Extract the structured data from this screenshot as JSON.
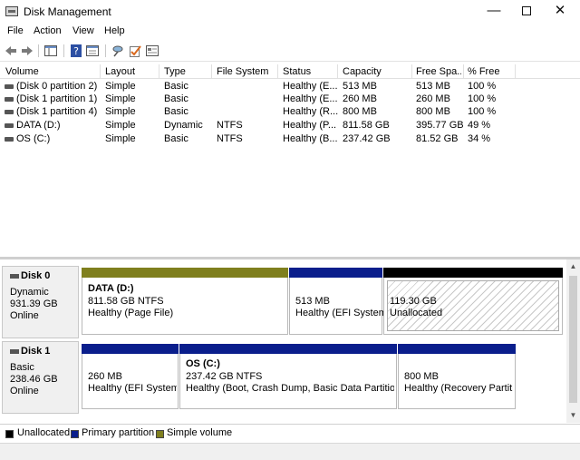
{
  "window": {
    "title": "Disk Management",
    "min": "—",
    "close": "✕"
  },
  "menu": [
    "File",
    "Action",
    "View",
    "Help"
  ],
  "toolbar": [
    "back-icon",
    "forward-icon",
    "show-hide-console-tree-icon",
    "help-icon",
    "properties-icon",
    "connect-icon",
    "check-icon",
    "console-icon"
  ],
  "columns": [
    "Volume",
    "Layout",
    "Type",
    "File System",
    "Status",
    "Capacity",
    "Free Spa...",
    "% Free"
  ],
  "volumes": [
    [
      "(Disk 0 partition 2)",
      "Simple",
      "Basic",
      "",
      "Healthy (E...",
      "513 MB",
      "513 MB",
      "100 %"
    ],
    [
      "(Disk 1 partition 1)",
      "Simple",
      "Basic",
      "",
      "Healthy (E...",
      "260 MB",
      "260 MB",
      "100 %"
    ],
    [
      "(Disk 1 partition 4)",
      "Simple",
      "Basic",
      "",
      "Healthy (R...",
      "800 MB",
      "800 MB",
      "100 %"
    ],
    [
      "DATA (D:)",
      "Simple",
      "Dynamic",
      "NTFS",
      "Healthy (P...",
      "811.58 GB",
      "395.77 GB",
      "49 %"
    ],
    [
      "OS (C:)",
      "Simple",
      "Basic",
      "NTFS",
      "Healthy (B...",
      "237.42 GB",
      "81.52 GB",
      "34 %"
    ]
  ],
  "disks": [
    {
      "name": "Disk 0",
      "type": "Dynamic",
      "size": "931.39 GB",
      "status": "Online",
      "partitions": [
        {
          "title": "DATA  (D:)",
          "size": "811.58 GB NTFS",
          "status": "Healthy (Page File)",
          "kind": "simple"
        },
        {
          "title": "",
          "size": "513 MB",
          "status": "Healthy (EFI System",
          "kind": "primary"
        },
        {
          "title": "",
          "size": "119.30 GB",
          "status": "Unallocated",
          "kind": "unallocated"
        }
      ]
    },
    {
      "name": "Disk 1",
      "type": "Basic",
      "size": "238.46 GB",
      "status": "Online",
      "partitions": [
        {
          "title": "",
          "size": "260 MB",
          "status": "Healthy (EFI System P",
          "kind": "primary"
        },
        {
          "title": "OS  (C:)",
          "size": "237.42 GB NTFS",
          "status": "Healthy (Boot, Crash Dump, Basic Data Partition)",
          "kind": "primary"
        },
        {
          "title": "",
          "size": "800 MB",
          "status": "Healthy (Recovery Partitio",
          "kind": "primary"
        }
      ]
    }
  ],
  "legend": [
    {
      "label": "Unallocated",
      "color": "#000000"
    },
    {
      "label": "Primary partition",
      "color": "#0a1e8c"
    },
    {
      "label": "Simple volume",
      "color": "#7f7f1e"
    }
  ],
  "colors": {
    "simple": "#7f7f1e",
    "primary": "#0a1e8c",
    "unallocated": "#000000"
  }
}
